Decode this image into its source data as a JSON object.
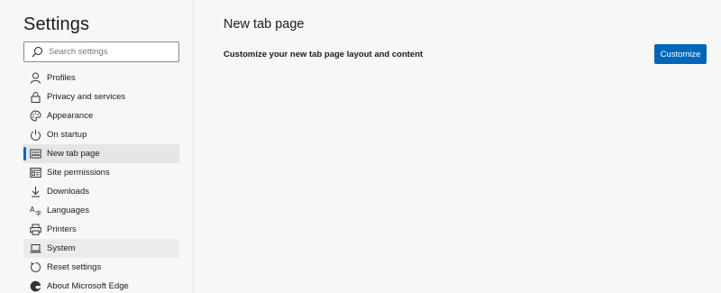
{
  "sidebar": {
    "title": "Settings",
    "search": {
      "placeholder": "Search settings",
      "value": ""
    },
    "items": [
      {
        "label": "Profiles",
        "icon": "person-icon"
      },
      {
        "label": "Privacy and services",
        "icon": "lock-icon"
      },
      {
        "label": "Appearance",
        "icon": "palette-icon"
      },
      {
        "label": "On startup",
        "icon": "power-icon"
      },
      {
        "label": "New tab page",
        "icon": "new-tab-icon",
        "state": "selected"
      },
      {
        "label": "Site permissions",
        "icon": "site-permissions-icon"
      },
      {
        "label": "Downloads",
        "icon": "download-icon"
      },
      {
        "label": "Languages",
        "icon": "language-icon"
      },
      {
        "label": "Printers",
        "icon": "printer-icon"
      },
      {
        "label": "System",
        "icon": "laptop-icon",
        "state": "hover"
      },
      {
        "label": "Reset settings",
        "icon": "reset-icon"
      },
      {
        "label": "About Microsoft Edge",
        "icon": "edge-icon"
      }
    ]
  },
  "main": {
    "title": "New tab page",
    "customize_row": {
      "label": "Customize your new tab page layout and content",
      "button_label": "Customize"
    }
  },
  "colors": {
    "accent": "#0067b8",
    "background": "#f7f7f7",
    "selected_bg": "#e6e6e6"
  }
}
